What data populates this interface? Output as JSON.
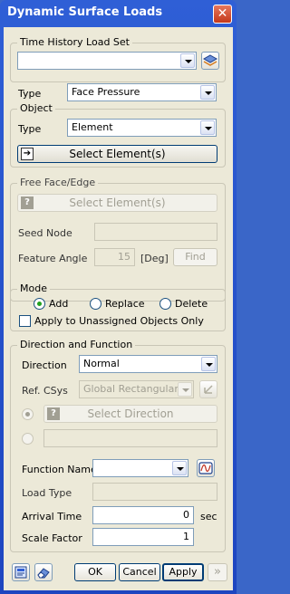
{
  "window": {
    "title": "Dynamic Surface Loads",
    "close_glyph": "✕"
  },
  "time_history": {
    "legend": "Time History Load Set",
    "value": ""
  },
  "type_row": {
    "label": "Type",
    "value": "Face Pressure"
  },
  "object": {
    "legend": "Object",
    "type_label": "Type",
    "type_value": "Element",
    "select_button": "Select Element(s)"
  },
  "free_face": {
    "legend": "Free Face/Edge",
    "select_button": "Select Element(s)",
    "seed_node_label": "Seed Node",
    "seed_node_value": "",
    "feature_angle_label": "Feature Angle",
    "feature_angle_value": "15",
    "feature_angle_unit": "[Deg]",
    "find_button": "Find"
  },
  "mode": {
    "legend": "Mode",
    "options": [
      "Add",
      "Replace",
      "Delete"
    ],
    "selected": "Add",
    "apply_unassigned_label": "Apply to Unassigned Objects Only",
    "apply_unassigned_checked": false
  },
  "direction_function": {
    "legend": "Direction and Function",
    "direction_label": "Direction",
    "direction_value": "Normal",
    "refcsys_label": "Ref. CSys",
    "refcsys_value": "Global Rectangular",
    "select_direction_button": "Select Direction",
    "vector_value": "",
    "function_name_label": "Function Name",
    "function_name_value": "",
    "load_type_label": "Load Type",
    "load_type_value": "",
    "arrival_time_label": "Arrival Time",
    "arrival_time_value": "0",
    "arrival_time_unit": "sec",
    "scale_factor_label": "Scale Factor",
    "scale_factor_value": "1"
  },
  "footer": {
    "ok": "OK",
    "cancel": "Cancel",
    "apply": "Apply",
    "more_glyph": "»"
  },
  "icons": {
    "load_set": "layers-icon",
    "function_graph": "function-graph-icon",
    "csys": "csys-icon",
    "report": "report-icon",
    "eraser": "eraser-icon"
  },
  "colors": {
    "titlebar": "#2f5fd6",
    "dialog_bg": "#ece9d8",
    "radio_dot": "#21a121"
  }
}
